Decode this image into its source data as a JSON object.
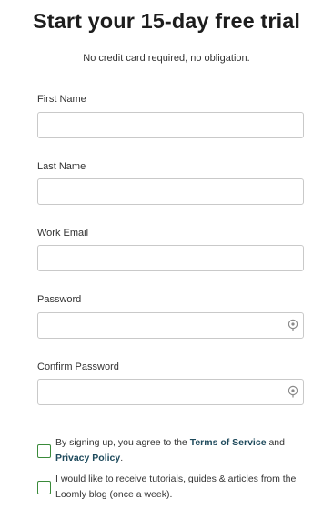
{
  "header": {
    "title": "Start your 15-day free trial",
    "subtitle": "No credit card required, no obligation."
  },
  "form": {
    "fields": [
      {
        "label": "First Name",
        "value": "",
        "placeholder": ""
      },
      {
        "label": "Last Name",
        "value": "",
        "placeholder": ""
      },
      {
        "label": "Work Email",
        "value": "",
        "placeholder": ""
      },
      {
        "label": "Password",
        "value": "",
        "placeholder": ""
      },
      {
        "label": "Confirm Password",
        "value": "",
        "placeholder": ""
      }
    ],
    "terms": {
      "checked": false,
      "prefix": "By signing up, you agree to the ",
      "tos_link": "Terms of Service",
      "and": " and ",
      "privacy_link": "Privacy Policy",
      "suffix": "."
    },
    "newsletter": {
      "checked": false,
      "text": "I would like to receive tutorials, guides & articles from the Loomly blog (once a week)."
    }
  },
  "colors": {
    "checkbox_border": "#3a8a3a",
    "link": "#1e4a5c",
    "input_border": "#c9c9c9",
    "eye_icon": "#8a8a8a"
  },
  "icons": {
    "password_toggle": "eye-icon"
  }
}
